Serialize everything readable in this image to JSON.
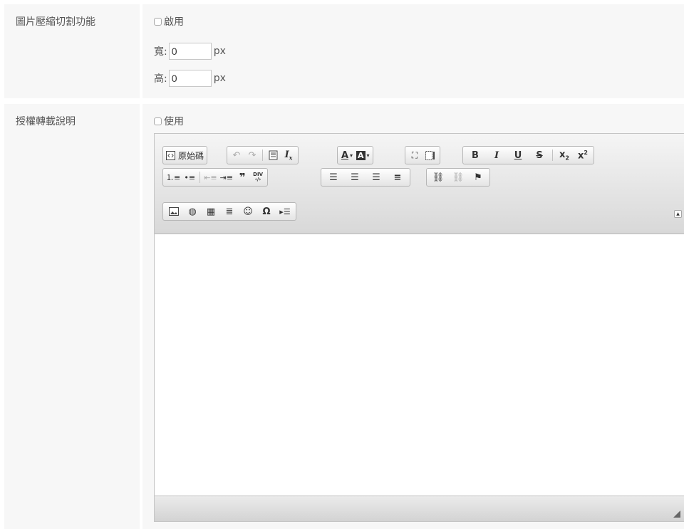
{
  "image_crop": {
    "label": "圖片壓縮切割功能",
    "enable_label": "啟用",
    "width_label": "寬:",
    "width_value": "0",
    "height_label": "高:",
    "height_value": "0",
    "unit": "px"
  },
  "license": {
    "label": "授權轉載說明",
    "use_label": "使用"
  },
  "editor": {
    "source_label": "原始碼",
    "bold": "B",
    "italic": "I",
    "underline": "U",
    "strike": "S",
    "omega": "Ω",
    "quote": "❞"
  }
}
